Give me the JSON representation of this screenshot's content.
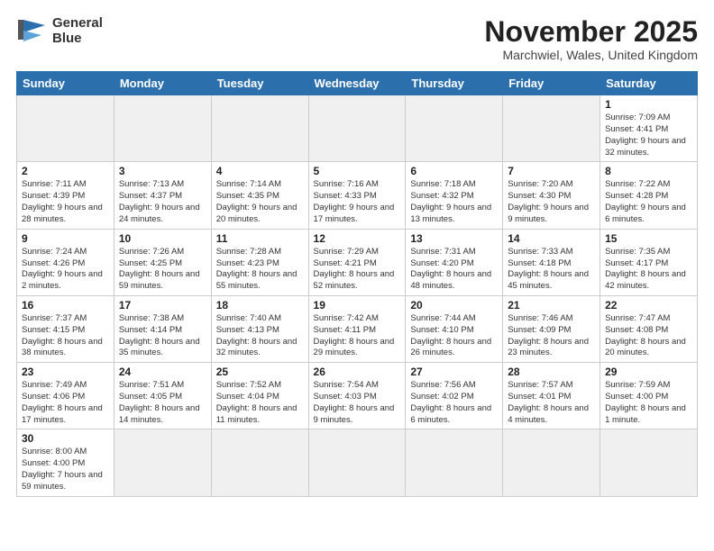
{
  "logo": {
    "line1": "General",
    "line2": "Blue"
  },
  "title": "November 2025",
  "subtitle": "Marchwiel, Wales, United Kingdom",
  "headers": [
    "Sunday",
    "Monday",
    "Tuesday",
    "Wednesday",
    "Thursday",
    "Friday",
    "Saturday"
  ],
  "weeks": [
    [
      {
        "day": "",
        "info": "",
        "empty": true
      },
      {
        "day": "",
        "info": "",
        "empty": true
      },
      {
        "day": "",
        "info": "",
        "empty": true
      },
      {
        "day": "",
        "info": "",
        "empty": true
      },
      {
        "day": "",
        "info": "",
        "empty": true
      },
      {
        "day": "",
        "info": "",
        "empty": true
      },
      {
        "day": "1",
        "info": "Sunrise: 7:09 AM\nSunset: 4:41 PM\nDaylight: 9 hours\nand 32 minutes."
      }
    ],
    [
      {
        "day": "2",
        "info": "Sunrise: 7:11 AM\nSunset: 4:39 PM\nDaylight: 9 hours\nand 28 minutes."
      },
      {
        "day": "3",
        "info": "Sunrise: 7:13 AM\nSunset: 4:37 PM\nDaylight: 9 hours\nand 24 minutes."
      },
      {
        "day": "4",
        "info": "Sunrise: 7:14 AM\nSunset: 4:35 PM\nDaylight: 9 hours\nand 20 minutes."
      },
      {
        "day": "5",
        "info": "Sunrise: 7:16 AM\nSunset: 4:33 PM\nDaylight: 9 hours\nand 17 minutes."
      },
      {
        "day": "6",
        "info": "Sunrise: 7:18 AM\nSunset: 4:32 PM\nDaylight: 9 hours\nand 13 minutes."
      },
      {
        "day": "7",
        "info": "Sunrise: 7:20 AM\nSunset: 4:30 PM\nDaylight: 9 hours\nand 9 minutes."
      },
      {
        "day": "8",
        "info": "Sunrise: 7:22 AM\nSunset: 4:28 PM\nDaylight: 9 hours\nand 6 minutes."
      }
    ],
    [
      {
        "day": "9",
        "info": "Sunrise: 7:24 AM\nSunset: 4:26 PM\nDaylight: 9 hours\nand 2 minutes."
      },
      {
        "day": "10",
        "info": "Sunrise: 7:26 AM\nSunset: 4:25 PM\nDaylight: 8 hours\nand 59 minutes."
      },
      {
        "day": "11",
        "info": "Sunrise: 7:28 AM\nSunset: 4:23 PM\nDaylight: 8 hours\nand 55 minutes."
      },
      {
        "day": "12",
        "info": "Sunrise: 7:29 AM\nSunset: 4:21 PM\nDaylight: 8 hours\nand 52 minutes."
      },
      {
        "day": "13",
        "info": "Sunrise: 7:31 AM\nSunset: 4:20 PM\nDaylight: 8 hours\nand 48 minutes."
      },
      {
        "day": "14",
        "info": "Sunrise: 7:33 AM\nSunset: 4:18 PM\nDaylight: 8 hours\nand 45 minutes."
      },
      {
        "day": "15",
        "info": "Sunrise: 7:35 AM\nSunset: 4:17 PM\nDaylight: 8 hours\nand 42 minutes."
      }
    ],
    [
      {
        "day": "16",
        "info": "Sunrise: 7:37 AM\nSunset: 4:15 PM\nDaylight: 8 hours\nand 38 minutes."
      },
      {
        "day": "17",
        "info": "Sunrise: 7:38 AM\nSunset: 4:14 PM\nDaylight: 8 hours\nand 35 minutes."
      },
      {
        "day": "18",
        "info": "Sunrise: 7:40 AM\nSunset: 4:13 PM\nDaylight: 8 hours\nand 32 minutes."
      },
      {
        "day": "19",
        "info": "Sunrise: 7:42 AM\nSunset: 4:11 PM\nDaylight: 8 hours\nand 29 minutes."
      },
      {
        "day": "20",
        "info": "Sunrise: 7:44 AM\nSunset: 4:10 PM\nDaylight: 8 hours\nand 26 minutes."
      },
      {
        "day": "21",
        "info": "Sunrise: 7:46 AM\nSunset: 4:09 PM\nDaylight: 8 hours\nand 23 minutes."
      },
      {
        "day": "22",
        "info": "Sunrise: 7:47 AM\nSunset: 4:08 PM\nDaylight: 8 hours\nand 20 minutes."
      }
    ],
    [
      {
        "day": "23",
        "info": "Sunrise: 7:49 AM\nSunset: 4:06 PM\nDaylight: 8 hours\nand 17 minutes."
      },
      {
        "day": "24",
        "info": "Sunrise: 7:51 AM\nSunset: 4:05 PM\nDaylight: 8 hours\nand 14 minutes."
      },
      {
        "day": "25",
        "info": "Sunrise: 7:52 AM\nSunset: 4:04 PM\nDaylight: 8 hours\nand 11 minutes."
      },
      {
        "day": "26",
        "info": "Sunrise: 7:54 AM\nSunset: 4:03 PM\nDaylight: 8 hours\nand 9 minutes."
      },
      {
        "day": "27",
        "info": "Sunrise: 7:56 AM\nSunset: 4:02 PM\nDaylight: 8 hours\nand 6 minutes."
      },
      {
        "day": "28",
        "info": "Sunrise: 7:57 AM\nSunset: 4:01 PM\nDaylight: 8 hours\nand 4 minutes."
      },
      {
        "day": "29",
        "info": "Sunrise: 7:59 AM\nSunset: 4:00 PM\nDaylight: 8 hours\nand 1 minute."
      }
    ],
    [
      {
        "day": "30",
        "info": "Sunrise: 8:00 AM\nSunset: 4:00 PM\nDaylight: 7 hours\nand 59 minutes."
      },
      {
        "day": "",
        "info": "",
        "empty": true
      },
      {
        "day": "",
        "info": "",
        "empty": true
      },
      {
        "day": "",
        "info": "",
        "empty": true
      },
      {
        "day": "",
        "info": "",
        "empty": true
      },
      {
        "day": "",
        "info": "",
        "empty": true
      },
      {
        "day": "",
        "info": "",
        "empty": true
      }
    ]
  ]
}
